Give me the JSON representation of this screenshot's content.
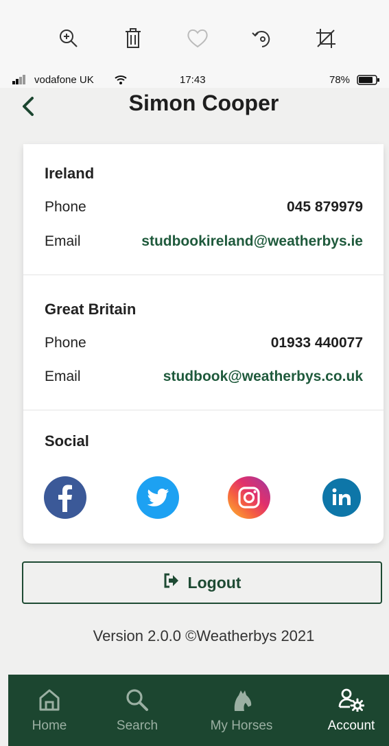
{
  "photo_toolbar": {
    "tools": [
      "zoom-in-icon",
      "trash-icon",
      "heart-icon",
      "rotate-icon",
      "crop-icon"
    ]
  },
  "status_bar": {
    "carrier": "vodafone UK",
    "time": "17:43",
    "battery": "78%"
  },
  "nav": {
    "title": "Simon Cooper"
  },
  "contacts": {
    "ireland": {
      "heading": "Ireland",
      "phone_label": "Phone",
      "phone": "045 879979",
      "email_label": "Email",
      "email": "studbookireland@weatherbys.ie"
    },
    "great_britain": {
      "heading": "Great Britain",
      "phone_label": "Phone",
      "phone": "01933 440077",
      "email_label": "Email",
      "email": "studbook@weatherbys.co.uk"
    },
    "social": {
      "heading": "Social",
      "icons": [
        "facebook-icon",
        "twitter-icon",
        "instagram-icon",
        "linkedin-icon"
      ]
    }
  },
  "logout": {
    "label": "Logout"
  },
  "version": "Version 2.0.0 ©Weatherbys 2021",
  "tab_bar": {
    "tabs": [
      {
        "label": "Home",
        "active": false
      },
      {
        "label": "Search",
        "active": false
      },
      {
        "label": "My Horses",
        "active": false
      },
      {
        "label": "Account",
        "active": true
      }
    ]
  },
  "colors": {
    "brand_green": "#1c4630",
    "email_green": "#1f5a3c",
    "facebook": "#3b5998",
    "twitter": "#1da1f2",
    "linkedin": "#0e76a8"
  }
}
